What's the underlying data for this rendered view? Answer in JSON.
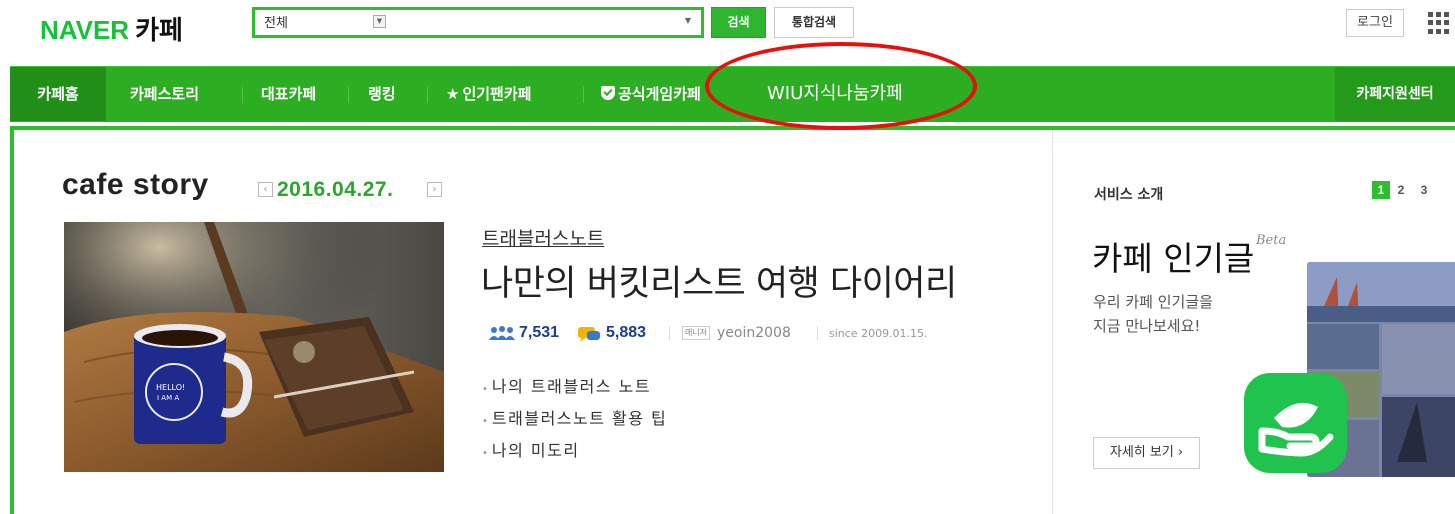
{
  "header": {
    "logo_naver": "NAVER",
    "logo_cafe": "카페",
    "search_scope": "전체",
    "search_value": "",
    "search_button": "검색",
    "total_search_button": "통합검색",
    "login_button": "로그인"
  },
  "nav": {
    "items": [
      "카페홈",
      "카페스토리",
      "대표카페",
      "랭킹",
      "인기팬카페",
      "공식게임카페",
      "WIU지식나눔카페"
    ],
    "support": "카페지원센터"
  },
  "story": {
    "section_title": "cafe story",
    "date": "2016.04.27.",
    "cafe_name": "트래블러스노트",
    "post_title": "나만의 버킷리스트 여행 다이어리",
    "members": "7,531",
    "posts": "5,883",
    "manager_label": "매니저",
    "manager_id": "yeoin2008",
    "since": "since 2009.01.15.",
    "bullets": [
      "나의 트래블러스 노트",
      "트래블러스노트 활용 팁",
      "나의 미도리"
    ]
  },
  "service": {
    "label": "서비스 소개",
    "pages": [
      "1",
      "2",
      "3"
    ],
    "active_page": "1",
    "title": "카페 인기글",
    "beta": "Beta",
    "desc_line1": "우리 카페 인기글을",
    "desc_line2": "지금 만나보세요!",
    "more_button": "자세히 보기 ›"
  },
  "colors": {
    "naver_green": "#2dbd2d",
    "nav_green": "#2cad22",
    "annotation_red": "#e8100c"
  }
}
